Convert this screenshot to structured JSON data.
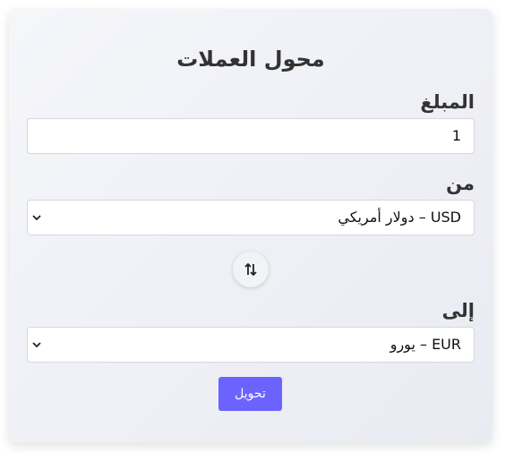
{
  "converter": {
    "title": "محول العملات",
    "amount_label": "المبلغ",
    "amount_value": "1",
    "from_label": "من",
    "from_selected": "USD – دولار أمريكي",
    "to_label": "إلى",
    "to_selected": "EUR – يورو",
    "swap_icon": "swap-vertical-arrows",
    "convert_label": "تحويل",
    "accent_color": "#6c63ff"
  }
}
